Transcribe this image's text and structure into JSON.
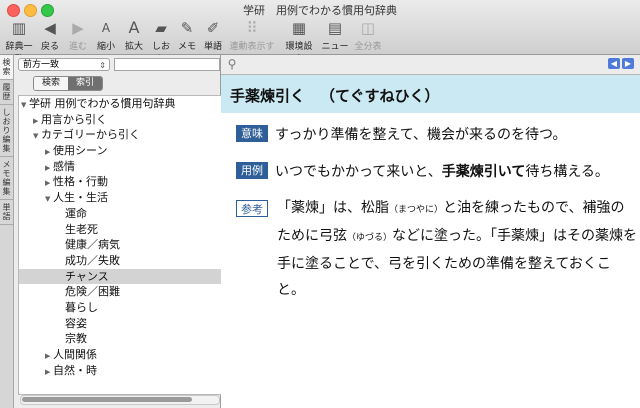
{
  "window": {
    "title": "学研　用例でわかる慣用句辞典"
  },
  "toolbar": [
    {
      "label": "辞典一覧",
      "icon": "books-icon",
      "enabled": true
    },
    {
      "label": "戻る",
      "icon": "back-arrow-icon",
      "enabled": true
    },
    {
      "label": "進む",
      "icon": "forward-arrow-icon",
      "enabled": false
    },
    {
      "label": "縮小",
      "icon": "font-smaller-icon",
      "enabled": true
    },
    {
      "label": "拡大",
      "icon": "font-larger-icon",
      "enabled": true
    },
    {
      "label": "しおり",
      "icon": "bookmark-icon",
      "enabled": true
    },
    {
      "label": "メモ",
      "icon": "memo-icon",
      "enabled": true
    },
    {
      "label": "単語",
      "icon": "word-icon",
      "enabled": true
    },
    {
      "label": "連動表示する",
      "icon": "linked-view-icon",
      "enabled": false
    },
    {
      "label": "環境設定",
      "icon": "preferences-icon",
      "enabled": true
    },
    {
      "label": "ニュース",
      "icon": "news-icon",
      "enabled": true
    },
    {
      "label": "全分表示",
      "icon": "full-view-icon",
      "enabled": false
    }
  ],
  "sidebar_tabs": [
    "検",
    "索",
    "履",
    "歴",
    "しおり",
    "編集",
    "メモ",
    "編集",
    "単",
    "語"
  ],
  "search": {
    "mode": "前方一致",
    "query": "",
    "tabs": [
      "検索",
      "索引"
    ],
    "active_tab": "索引"
  },
  "tree": [
    {
      "text": "学研 用例でわかる慣用句辞典",
      "level": 0,
      "twisty": "open"
    },
    {
      "text": "用言から引く",
      "level": 1,
      "twisty": "closed"
    },
    {
      "text": "カテゴリーから引く",
      "level": 1,
      "twisty": "open"
    },
    {
      "text": "使用シーン",
      "level": 2,
      "twisty": "closed"
    },
    {
      "text": "感情",
      "level": 2,
      "twisty": "closed"
    },
    {
      "text": "性格・行動",
      "level": 2,
      "twisty": "closed"
    },
    {
      "text": "人生・生活",
      "level": 2,
      "twisty": "open"
    },
    {
      "text": "運命",
      "level": 3,
      "twisty": ""
    },
    {
      "text": "生老死",
      "level": 3,
      "twisty": ""
    },
    {
      "text": "健康／病気",
      "level": 3,
      "twisty": ""
    },
    {
      "text": "成功／失敗",
      "level": 3,
      "twisty": ""
    },
    {
      "text": "チャンス",
      "level": 3,
      "twisty": "",
      "selected": true
    },
    {
      "text": "危険／困難",
      "level": 3,
      "twisty": ""
    },
    {
      "text": "暮らし",
      "level": 3,
      "twisty": ""
    },
    {
      "text": "容姿",
      "level": 3,
      "twisty": ""
    },
    {
      "text": "宗教",
      "level": 3,
      "twisty": ""
    },
    {
      "text": "人間関係",
      "level": 2,
      "twisty": "closed"
    },
    {
      "text": "自然・時",
      "level": 2,
      "twisty": "closed"
    }
  ],
  "entry": {
    "headword": "手薬煉引く",
    "reading": "（てぐすねひく）",
    "meaning_label": "意味",
    "meaning": "すっかり準備を整えて、機会が来るのを待つ。",
    "example_label": "用例",
    "example_pre": "いつでもかかって来いと、",
    "example_bold": "手薬煉引いて",
    "example_post": "待ち構える。",
    "note_label": "参考",
    "note_1": "「薬煉」は、松脂",
    "note_ruby_1": "（まつやに）",
    "note_2": "と油を練ったもので、補強のために弓弦",
    "note_ruby_2": "（ゆづる）",
    "note_3": "などに塗った。「手薬煉」はその薬煉を手に塗ることで、弓を引くための準備を整えておくこと。"
  }
}
